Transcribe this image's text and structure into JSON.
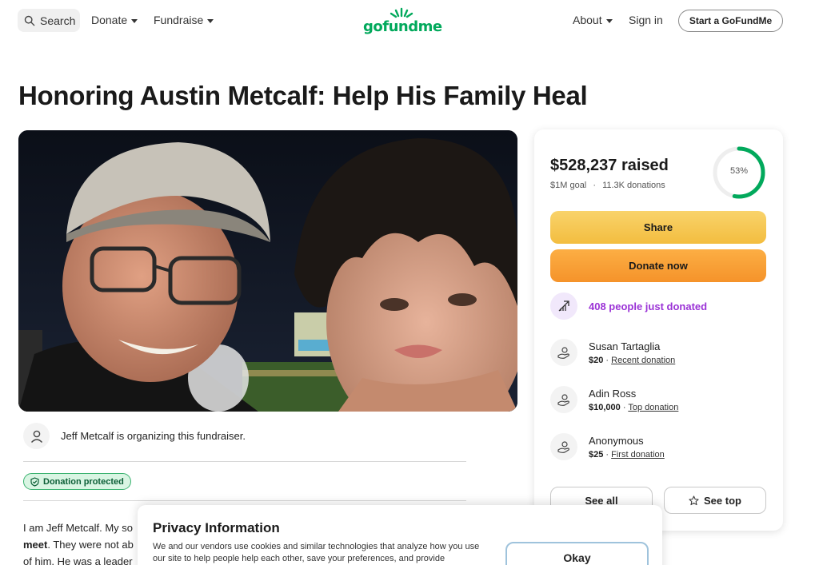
{
  "header": {
    "search_label": "Search",
    "nav_donate": "Donate",
    "nav_fundraise": "Fundraise",
    "logo_text": "gofundme",
    "nav_about": "About",
    "sign_in": "Sign in",
    "start_button": "Start a GoFundMe"
  },
  "page_title": "Honoring Austin Metcalf: Help His Family Heal",
  "organizer": {
    "text": "Jeff Metcalf is organizing this fundraiser."
  },
  "badge": {
    "label": "Donation protected"
  },
  "story": {
    "line1": "I am Jeff Metcalf. My so",
    "line2_bold": "meet",
    "line2_rest": ". They were not ab",
    "line3": "of him. He was a leader"
  },
  "donation_card": {
    "raised": "$528,237 raised",
    "goal": "$1M goal",
    "separator": "·",
    "donations_count": "11.3K donations",
    "progress_label": "53%",
    "progress_fraction": 0.53,
    "share_label": "Share",
    "donate_label": "Donate now",
    "just_donated": "408 people just donated",
    "donors": [
      {
        "name": "Susan Tartaglia",
        "amount": "$20",
        "type": "Recent donation"
      },
      {
        "name": "Adin Ross",
        "amount": "$10,000",
        "type": "Top donation"
      },
      {
        "name": "Anonymous",
        "amount": "$25",
        "type": "First donation"
      }
    ],
    "see_all_label": "See all",
    "see_top_label": "See top"
  },
  "privacy": {
    "title": "Privacy Information",
    "body": "We and our vendors use cookies and similar technologies that analyze how you use our site to help people help each other, save your preferences, and provide",
    "okay_label": "Okay"
  },
  "colors": {
    "brand_green": "#02a95c",
    "share_yellow": "#f3bd3f",
    "donate_orange": "#f5932a",
    "purple": "#9b33d6"
  }
}
